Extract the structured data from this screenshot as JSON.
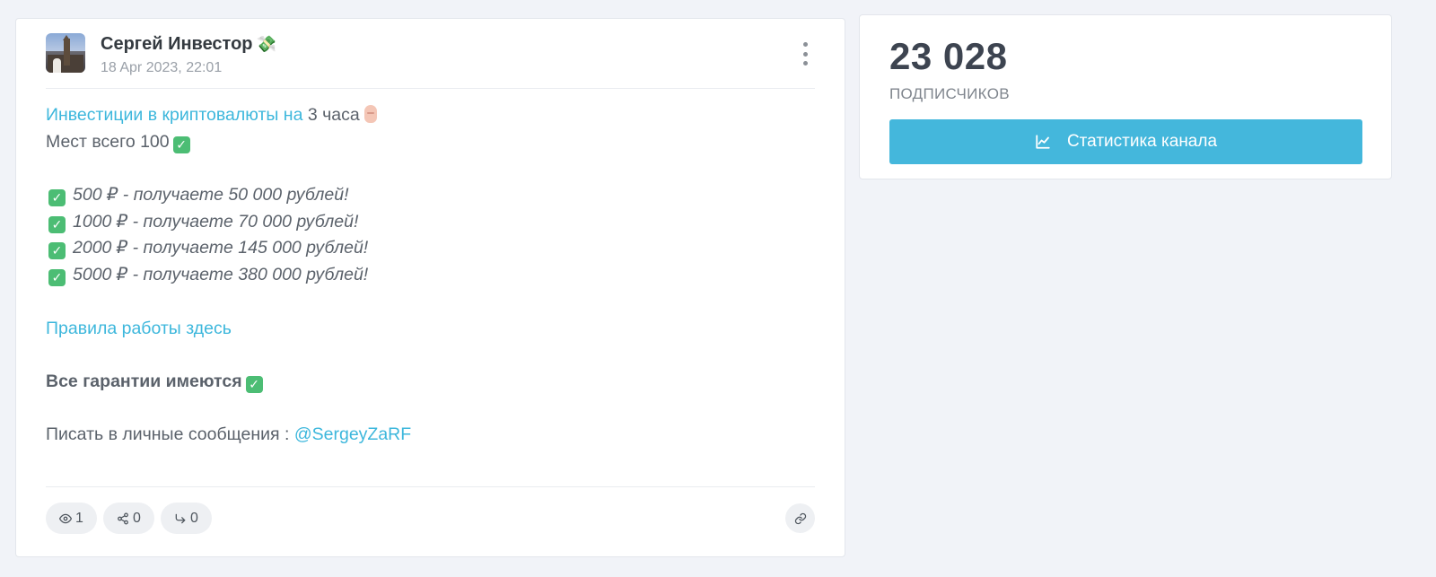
{
  "post": {
    "author": "Сергей Инвестор",
    "author_emoji": "💸",
    "date": "18 Apr 2023, 22:01",
    "body": {
      "line1_link": "Инвестиции в криптовалюты на",
      "line1_text": "3 часа",
      "line2_text": "Мест всего 100",
      "offers": [
        "500 ₽ - получаете 50 000 рублей!",
        "1000 ₽ - получаете 70 000 рублей!",
        "2000 ₽ - получаете 145 000 рублей!",
        "5000 ₽ - получаете 380 000 рублей!"
      ],
      "rules_link": "Правила работы здесь",
      "guarantee": "Все гарантии имеются",
      "contact_text": "Писать в личные сообщения :",
      "contact_handle": "@SergeyZaRF"
    },
    "footer": {
      "views": "1",
      "shares": "0",
      "forwards": "0"
    }
  },
  "channel": {
    "subscribers_count": "23 028",
    "subscribers_label": "ПОДПИСЧИКОВ",
    "stats_button": "Статистика канала"
  },
  "colors": {
    "accent": "#44b7dc",
    "link": "#3db7dc",
    "check": "#4cbd74"
  },
  "icons": [
    "more-vertical-icon",
    "check-icon",
    "eye-icon",
    "share-icon",
    "forward-icon",
    "link-icon",
    "chart-line-icon"
  ]
}
